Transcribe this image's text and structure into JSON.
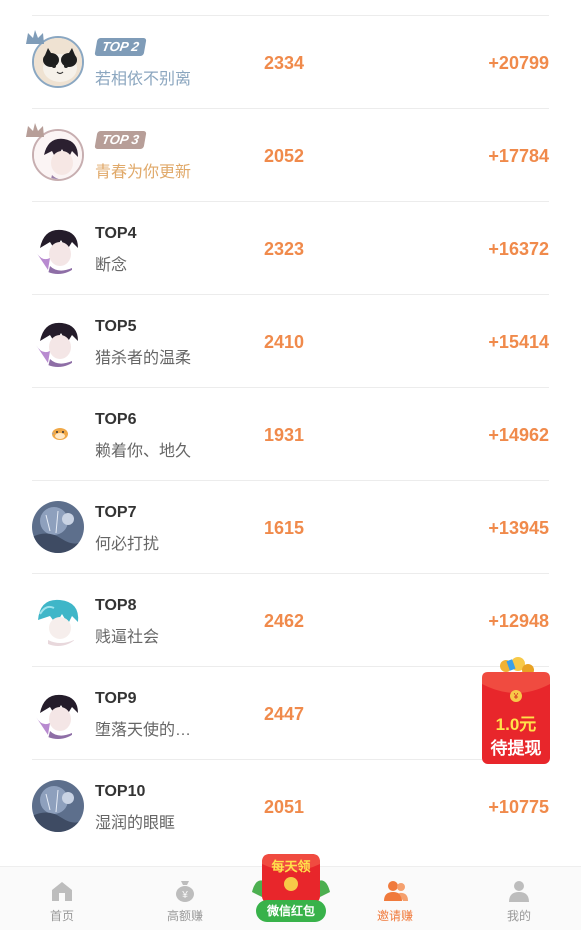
{
  "rows": [
    {
      "rank": "TOP 2",
      "name": "若相依不别离",
      "score": "2334",
      "gain": "+20799"
    },
    {
      "rank": "TOP 3",
      "name": "青春为你更新",
      "score": "2052",
      "gain": "+17784"
    },
    {
      "rank": "TOP4",
      "name": "断念",
      "score": "2323",
      "gain": "+16372"
    },
    {
      "rank": "TOP5",
      "name": "猎杀者的温柔",
      "score": "2410",
      "gain": "+15414"
    },
    {
      "rank": "TOP6",
      "name": "赖着你、地久",
      "score": "1931",
      "gain": "+14962"
    },
    {
      "rank": "TOP7",
      "name": "何必打扰",
      "score": "1615",
      "gain": "+13945"
    },
    {
      "rank": "TOP8",
      "name": "贱逼社会",
      "score": "2462",
      "gain": "+12948"
    },
    {
      "rank": "TOP9",
      "name": "堕落天使的…",
      "score": "2447",
      "gain": ""
    },
    {
      "rank": "TOP10",
      "name": "湿润的眼眶",
      "score": "2051",
      "gain": "+10775"
    }
  ],
  "float_packet": {
    "amount": "1.0元",
    "caption": "待提现"
  },
  "nav": {
    "home": "首页",
    "high": "高额赚",
    "center_top": "每天领",
    "center_label": "微信红包",
    "invite": "邀请赚",
    "mine": "我的"
  },
  "colors": {
    "accent": "#f08a4b",
    "active_nav": "#f07a3c",
    "silver": "#7f9cb8",
    "bronze": "#b79e98"
  }
}
